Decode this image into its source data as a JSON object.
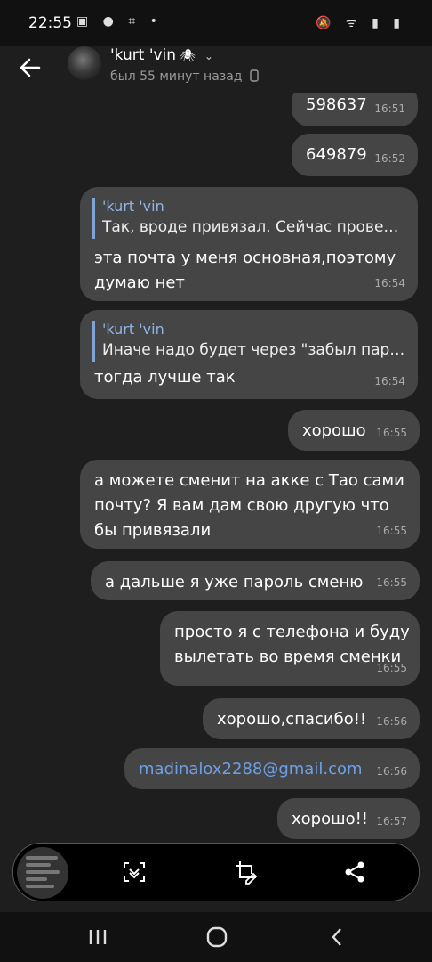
{
  "status_bar": {
    "time": "22:55",
    "left_icons": "▣ ● ⌗ •",
    "right_icons": "🔕 ᯤ ▮ ▮"
  },
  "header": {
    "contact_name": "'kurt 'vin",
    "name_suffix": "🕷",
    "contact_status": "был 55 минут назад"
  },
  "messages": [
    {
      "text": "598637",
      "time": "16:51"
    },
    {
      "text": "649879",
      "time": "16:52"
    },
    {
      "quote_name": "'kurt 'vin",
      "quote_text": "Так, вроде привязал. Сейчас прове…",
      "text": "эта почта у меня основная,поэтому\nдумаю нет",
      "time": "16:54"
    },
    {
      "quote_name": "'kurt 'vin",
      "quote_text": "Иначе надо будет через \"забыл пар…",
      "text": "тогда лучше так",
      "time": "16:54"
    },
    {
      "text": "хорошо",
      "time": "16:55"
    },
    {
      "text": "а можете сменит на акке с Тао сами\nпочту? Я вам дам свою другую что\nбы привязали",
      "time": "16:55"
    },
    {
      "text": "а дальше я уже пароль сменю",
      "time": "16:55"
    },
    {
      "text": "просто я с телефона и буду\nвылетать во время сменки",
      "time": "16:55"
    },
    {
      "text": "хорошо,спасибо!!",
      "time": "16:56"
    },
    {
      "text": "madinalox2288@gmail.com",
      "time": "16:56"
    },
    {
      "text": "хорошо!!",
      "time": "16:57"
    }
  ],
  "colors": {
    "bubble": "#454545",
    "background": "#1e1e1e",
    "link": "#6ea0e6",
    "quote_accent": "#7ea3d6"
  }
}
